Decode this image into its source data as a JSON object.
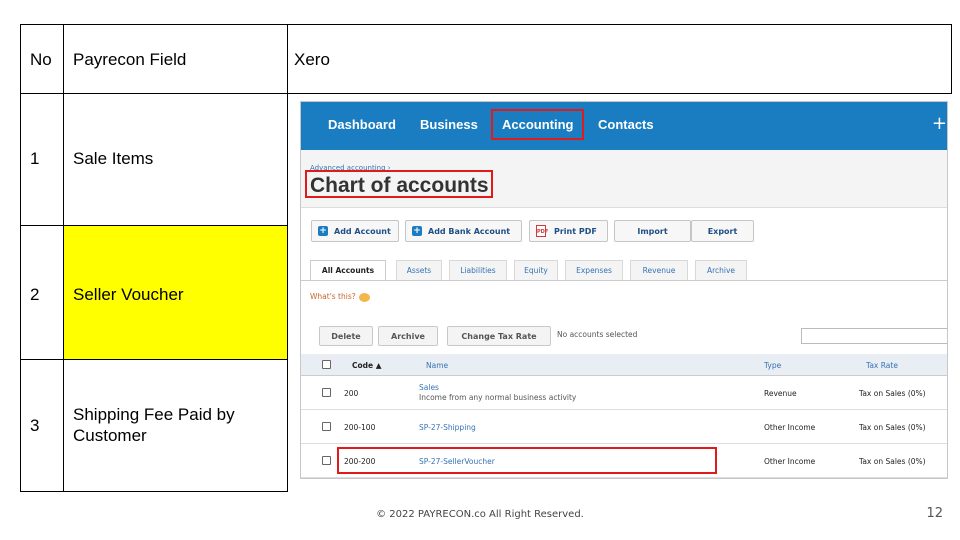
{
  "table": {
    "headers": {
      "no": "No",
      "field": "Payrecon Field",
      "xero": "Xero"
    },
    "rows": [
      {
        "no": "1",
        "field": "Sale Items"
      },
      {
        "no": "2",
        "field": "Seller Voucher",
        "highlight": "#ffff00"
      },
      {
        "no": "3",
        "field_line1": "Shipping Fee Paid by",
        "field_line2": "Customer"
      }
    ]
  },
  "xero": {
    "nav": {
      "items": [
        "Dashboard",
        "Business",
        "Accounting",
        "Contacts"
      ],
      "plus": "+",
      "active": "Accounting"
    },
    "breadcrumb": "Advanced accounting ›",
    "title": "Chart of accounts",
    "toolbar": {
      "add_account": "Add Account",
      "add_bank_account": "Add Bank Account",
      "print_pdf": "Print PDF",
      "import": "Import",
      "export": "Export"
    },
    "tabs": [
      "All Accounts",
      "Assets",
      "Liabilities",
      "Equity",
      "Expenses",
      "Revenue",
      "Archive"
    ],
    "whats_this": "What's this?",
    "table_actions": {
      "delete": "Delete",
      "archive": "Archive",
      "change_tax_rate": "Change Tax Rate",
      "status": "No accounts selected"
    },
    "columns": {
      "code": "Code ▲",
      "name": "Name",
      "type": "Type",
      "tax_rate": "Tax Rate"
    },
    "accounts": [
      {
        "code": "200",
        "name": "Sales",
        "description": "Income from any normal business activity",
        "type": "Revenue",
        "tax_rate": "Tax on Sales (0%)"
      },
      {
        "code": "200-100",
        "name": "SP-27-Shipping",
        "type": "Other Income",
        "tax_rate": "Tax on Sales (0%)"
      },
      {
        "code": "200-200",
        "name": "SP-27-SellerVoucher",
        "type": "Other Income",
        "tax_rate": "Tax on Sales (0%)"
      }
    ],
    "colors": {
      "nav": "#1a7dc2",
      "highlight_box": "#e01b1b",
      "link": "#3673b3"
    }
  },
  "footer": {
    "copyright": "© 2022 PAYRECON.co All Right Reserved.",
    "page": "12"
  }
}
